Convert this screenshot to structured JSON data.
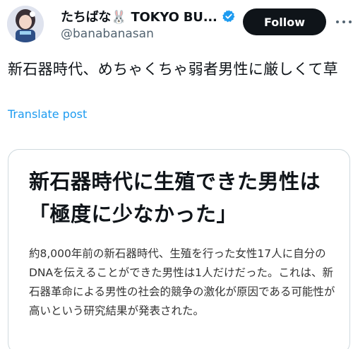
{
  "author": {
    "display_name": "たちばな🐰 TOKYO BU...",
    "handle": "@banabanasan"
  },
  "follow_button": {
    "label": "Follow"
  },
  "tweet": {
    "text": "新石器時代、めちゃくちゃ弱者男性に厳しくて草",
    "translate_label": "Translate post"
  },
  "card": {
    "title": "新石器時代に生殖できた男性は「極度に少なかった」",
    "body": "約8,000年前の新石器時代、生殖を行った女性17人に自分のDNAを伝えることができた男性は1人だけだった。これは、新石器革命による男性の社会的競争の激化が原因である可能性が高いという研究結果が発表された。"
  },
  "colors": {
    "accent": "#1d9bf0",
    "text": "#0f1419",
    "secondary": "#536471",
    "border": "#cfd9de"
  },
  "icons": [
    "avatar-image",
    "verified-badge-icon",
    "more-options-icon"
  ]
}
